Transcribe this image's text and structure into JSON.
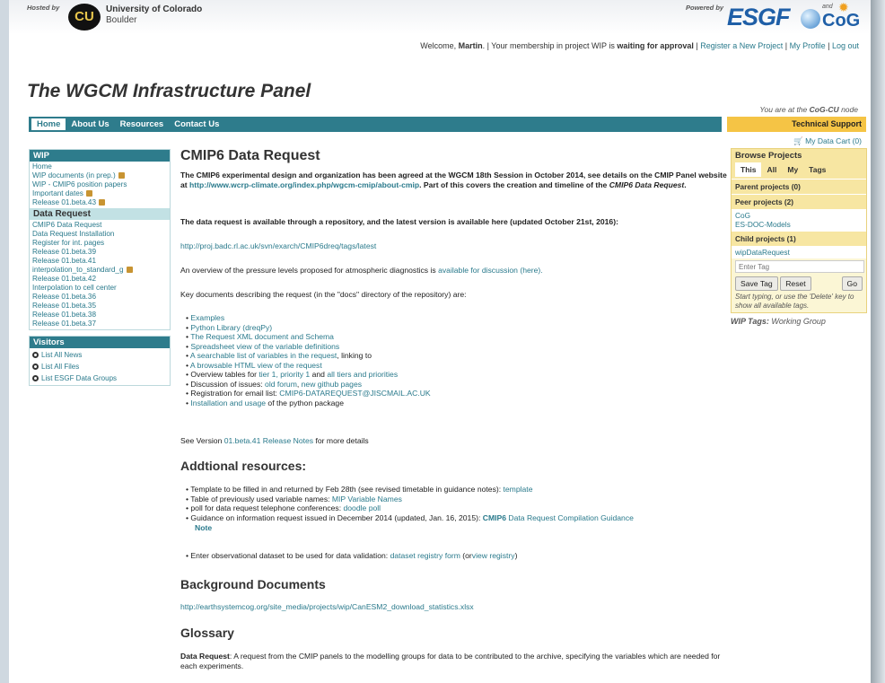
{
  "header": {
    "hosted_by": "Hosted by",
    "university": "University of Colorado",
    "campus": "Boulder",
    "logo_text": "CU",
    "powered_by": "Powered by",
    "esgf": "ESGF",
    "and_text": "and",
    "cog": "CoG"
  },
  "welcome": {
    "prefix": "Welcome,",
    "user": "Martin",
    "mid": ". | Your membership in project WIP is",
    "status": "waiting for approval",
    "sep": " | ",
    "register": "Register a New Project",
    "profile": "My Profile",
    "logout": "Log out"
  },
  "page_title": "The WGCM Infrastructure Panel",
  "node_info": {
    "prefix": "You are at the",
    "node": "CoG-CU",
    "suffix": "node"
  },
  "nav": [
    "Home",
    "About Us",
    "Resources",
    "Contact Us"
  ],
  "tech_support": "Technical Support",
  "cart": "My Data Cart (0)",
  "left": {
    "wip_title": "WIP",
    "wip_items": [
      {
        "t": "Home",
        "lock": false
      },
      {
        "t": "WIP documents (in prep.)",
        "lock": true
      },
      {
        "t": "WIP - CMIP6 position papers",
        "lock": false
      },
      {
        "t": "Important dates",
        "lock": true
      },
      {
        "t": "Release 01.beta.43",
        "lock": true
      }
    ],
    "dr_title": "Data Request",
    "dr_items": [
      {
        "t": "CMIP6 Data Request",
        "lock": false
      },
      {
        "t": "Data Request Installation",
        "lock": false
      },
      {
        "t": "Register for int. pages",
        "lock": false
      },
      {
        "t": "Release 01.beta.39",
        "lock": false
      },
      {
        "t": "Release 01.beta.41",
        "lock": false
      },
      {
        "t": "interpolation_to_standard_g",
        "lock": true
      },
      {
        "t": "Release 01.beta.42",
        "lock": false
      },
      {
        "t": "Interpolation to cell center",
        "lock": false
      },
      {
        "t": "Release 01.beta.36",
        "lock": false
      },
      {
        "t": "Release 01.beta.35",
        "lock": false
      },
      {
        "t": "Release 01.beta.38",
        "lock": false
      },
      {
        "t": "Release 01.beta.37",
        "lock": false
      }
    ],
    "visitors_title": "Visitors",
    "visitors": [
      "List All News",
      "List All Files",
      "List ESGF Data Groups"
    ]
  },
  "main": {
    "h1": "CMIP6 Data Request",
    "intro_a": "The CMIP6 experimental design and organization has been agreed at the WGCM 18th Session in October 2014, see details on the CMIP Panel website at",
    "intro_link": "http://www.wcrp-climate.org/index.php/wgcm-cmip/about-cmip",
    "intro_b": ". Part of this covers the creation and",
    "intro_c": "timeline",
    "intro_d": "of the",
    "intro_e": "CMIP6 Data Request",
    "intro_f": ".",
    "avail": "The data request is available through a repository, and the latest version is available here (updated  October 21st, 2016):",
    "repo_link": "http://proj.badc.rl.ac.uk/svn/exarch/CMIP6dreq/tags/latest",
    "overview_a": "An overview of the pressure levels proposed for atmospheric diagnostics is",
    "overview_link": "available for discussion (here).",
    "keydocs": "Key documents describing the request (in the \"docs\" directory of the repository) are:",
    "docs": [
      {
        "pre": "",
        "link": "Examples",
        "post": ""
      },
      {
        "pre": "",
        "link": "Python Library (dreqPy)",
        "post": ""
      },
      {
        "pre": "",
        "link": "The Request XML document and Schema",
        "post": ""
      },
      {
        "pre": "",
        "link": "Spreadsheet view of the variable definitions",
        "post": ""
      },
      {
        "pre": "",
        "link": "A searchable list of variables in the request",
        "post": ", linking to"
      },
      {
        "pre": "",
        "link": "A browsable HTML view of the request",
        "post": ""
      },
      {
        "pre": "Overview tables for ",
        "link": "tier 1, priority 1",
        "post": " and ",
        "link2": "all tiers and priorities"
      },
      {
        "pre": "Discussion of issues: ",
        "link": "old forum",
        "post": ", ",
        "link2": "new github pages"
      },
      {
        "pre": "Registration for email list: ",
        "link": "CMIP6-DATAREQUEST@JISCMAIL.AC.UK",
        "post": ""
      },
      {
        "pre": "",
        "link": "Installation and usage",
        "post": " of the python package"
      }
    ],
    "see_a": "See Version",
    "see_link": "01.beta.41 Release Notes",
    "see_b": "for more details",
    "h2_add": "Addtional resources:",
    "add": [
      {
        "pre": "Template to be filled in and returned by Feb 28th (see revised timetable in guidance notes): ",
        "link": "template",
        "post": ""
      },
      {
        "pre": "Table of  previously used variable names: ",
        "link": "MIP Variable Names",
        "post": ""
      },
      {
        "pre": " poll for data request telephone conferences: ",
        "link": "doodle poll",
        "post": ""
      }
    ],
    "guid_a": "Guidance on information request issued in December 2014 (updated, Jan. 16, 2015):",
    "guid_b": "CMIP6",
    "guid_link": "Data Request Compilation Guidance",
    "guid_c": "Note",
    "obs_a": "Enter observational dataset to be used for data validation:",
    "obs_link": "dataset registry form",
    "obs_b": "(or",
    "obs_link2": "view registry",
    "obs_c": ")",
    "h2_bg": "Background Documents",
    "bg_link": "http://earthsystemcog.org/site_media/projects/wip/CanESM2_download_statistics.xlsx",
    "h2_gl": "Glossary",
    "gl_term": "Data Request",
    "gl_def": ": A request from the CMIP panels to the modelling groups for data to be contributed to the archive, specifying the variables which are needed for each experiments."
  },
  "right": {
    "title": "Browse Projects",
    "tabs": [
      "This",
      "All",
      "My",
      "Tags"
    ],
    "parent": "Parent projects (0)",
    "peer": "Peer projects (2)",
    "peer_items": [
      "CoG",
      "ES-DOC-Models"
    ],
    "child": "Child projects (1)",
    "child_items": [
      "wipDataRequest"
    ],
    "tag_placeholder": "Enter Tag",
    "save": "Save Tag",
    "reset": "Reset",
    "go": "Go",
    "hint": "Start typing, or use the 'Delete' key to show all available tags.",
    "wip_tags_label": "WIP Tags:",
    "wip_tags": "Working Group"
  }
}
